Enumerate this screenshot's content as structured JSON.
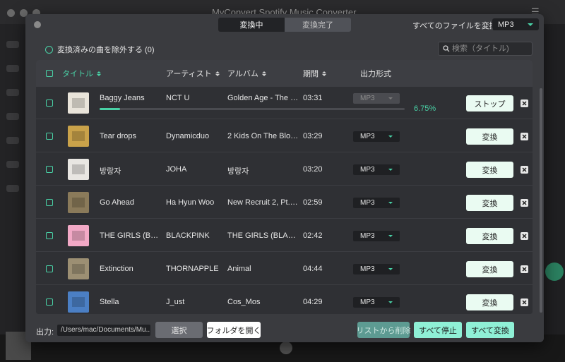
{
  "background": {
    "title": "MyConvert Spotify Music Converter"
  },
  "tabs": [
    {
      "label": "変換中",
      "active": true
    },
    {
      "label": "変換完了",
      "active": false
    }
  ],
  "convert_all": {
    "label": "すべてのファイルを変換:",
    "format": "MP3"
  },
  "exclude_converted": {
    "label": "変換済みの曲を除外する (0)"
  },
  "search": {
    "placeholder": "検索（タイトル)"
  },
  "table": {
    "headers": {
      "title": "タイトル",
      "artist": "アーティスト",
      "album": "アルバム",
      "duration": "期間",
      "format": "出力形式"
    },
    "rows": [
      {
        "title": "Baggy Jeans",
        "artist": "NCT U",
        "album": "Golden Age - The 4th ...",
        "duration": "03:31",
        "format": "MP3",
        "action": "ストップ",
        "converting": true,
        "progress": 6.75,
        "progress_label": "6.75%",
        "art_color": "#e9e4da"
      },
      {
        "title": "Tear drops",
        "artist": "Dynamicduo",
        "album": "2 Kids On The Block -...",
        "duration": "03:29",
        "format": "MP3",
        "action": "変換",
        "art_color": "#c9a24a"
      },
      {
        "title": "방랑자",
        "artist": "JOHA",
        "album": "방랑자",
        "duration": "03:20",
        "format": "MP3",
        "action": "変換",
        "art_color": "#e8e6e2"
      },
      {
        "title": "Go Ahead",
        "artist": "Ha Hyun Woo",
        "album": "New Recruit 2, Pt. 1 (...",
        "duration": "02:59",
        "format": "MP3",
        "action": "変換",
        "art_color": "#8a7a5a"
      },
      {
        "title": "THE GIRLS (BLACK...",
        "artist": "BLACKPINK",
        "album": "THE GIRLS (BLACKPI...",
        "duration": "02:42",
        "format": "MP3",
        "action": "変換",
        "art_color": "#f2a9c6"
      },
      {
        "title": "Extinction",
        "artist": "THORNAPPLE",
        "album": "Animal",
        "duration": "04:44",
        "format": "MP3",
        "action": "変換",
        "art_color": "#9c8f73"
      },
      {
        "title": "Stella",
        "artist": "J_ust",
        "album": "Cos_Mos",
        "duration": "04:29",
        "format": "MP3",
        "action": "変換",
        "art_color": "#4b7fc4"
      }
    ]
  },
  "footer": {
    "output_label": "出力:",
    "output_path": "/Users/mac/Documents/Mu...",
    "select": "選択",
    "open_folder": "フォルダを開く",
    "remove_from_list": "リストから削除",
    "stop_all": "すべて停止",
    "convert_all": "すべて変換"
  },
  "colors": {
    "accent": "#49d1a6",
    "dialog_bg": "#3a3b3f",
    "row_bg": "#2f3034"
  }
}
